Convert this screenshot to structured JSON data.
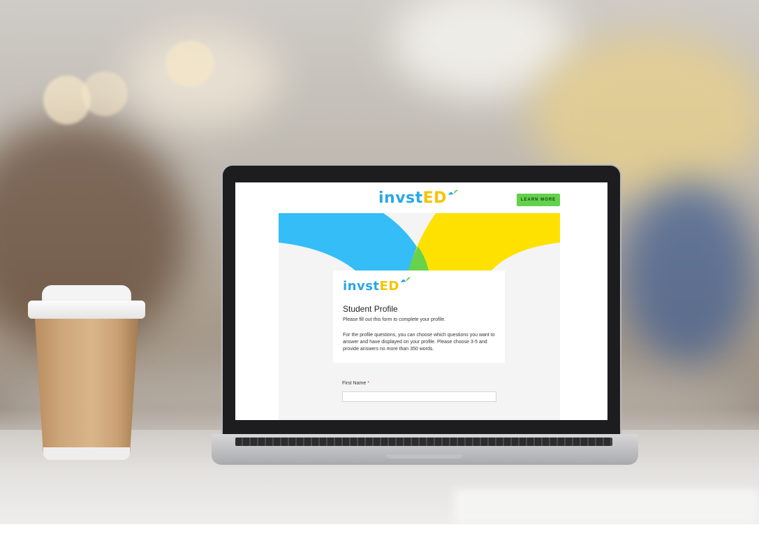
{
  "site": {
    "logo_text_a": "invst",
    "logo_text_b": "ED",
    "learn_more_label": "LEARN MORE"
  },
  "form": {
    "card_logo_a": "invst",
    "card_logo_b": "ED",
    "title": "Student Profile",
    "subtitle": "Please fill out this form to complete your profile.",
    "description": "For the profile questions, you can choose which questions you want to answer and have displayed on your profile. Please choose 3-5 and provide answers no more than 350 words.",
    "first_name_label": "First Name",
    "required_mark": "*",
    "first_name_value": ""
  },
  "colors": {
    "brand_blue": "#2aa7e6",
    "brand_yellow": "#f5c400",
    "accent_green": "#62d24a"
  }
}
